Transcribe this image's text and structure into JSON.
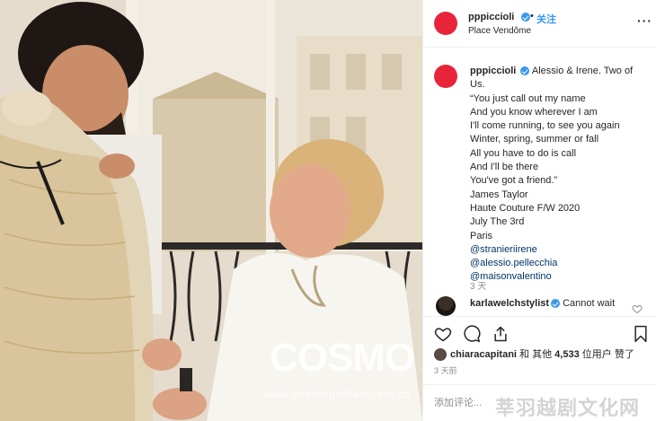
{
  "post": {
    "username": "pppiccioli",
    "separator": "•",
    "follow_label": "关注",
    "location": "Place Vendôme",
    "more_icon": "more-icon"
  },
  "caption": {
    "username": "pppiccioli",
    "lines": [
      "Alessio & Irene. Two of",
      "Us.",
      "“You just call out my name",
      "And you know wherever I am",
      "I'll come running, to see you again",
      "Winter, spring, summer or fall",
      "All you have to do is call",
      "And I'll be there",
      "You've got a friend.”",
      "James Taylor",
      "Haute Couture F/W 2020",
      "July The 3rd",
      "Paris"
    ],
    "tags": [
      "@stranieriirene",
      "@alessio.pellecchia",
      "@maisonvalentino"
    ],
    "time": "3 天"
  },
  "comment": {
    "username": "karlawelchstylist",
    "text": "Cannot wait"
  },
  "likes": {
    "liker": "chiaracapitani",
    "middle": "和 其他",
    "count": "4,533",
    "suffix": "位用户 赞了"
  },
  "post_time": "3 天前",
  "add_comment": {
    "placeholder": "添加评论..."
  },
  "watermarks": {
    "photo_brand": "COSMO",
    "photo_site": "www.cosmopolitan.com.cn",
    "panel_site": "莘羽越剧文化网"
  },
  "colors": {
    "accent": "#3897f0",
    "avatar": "#e8243a",
    "link": "#003569",
    "muted": "#8e8e8e"
  }
}
